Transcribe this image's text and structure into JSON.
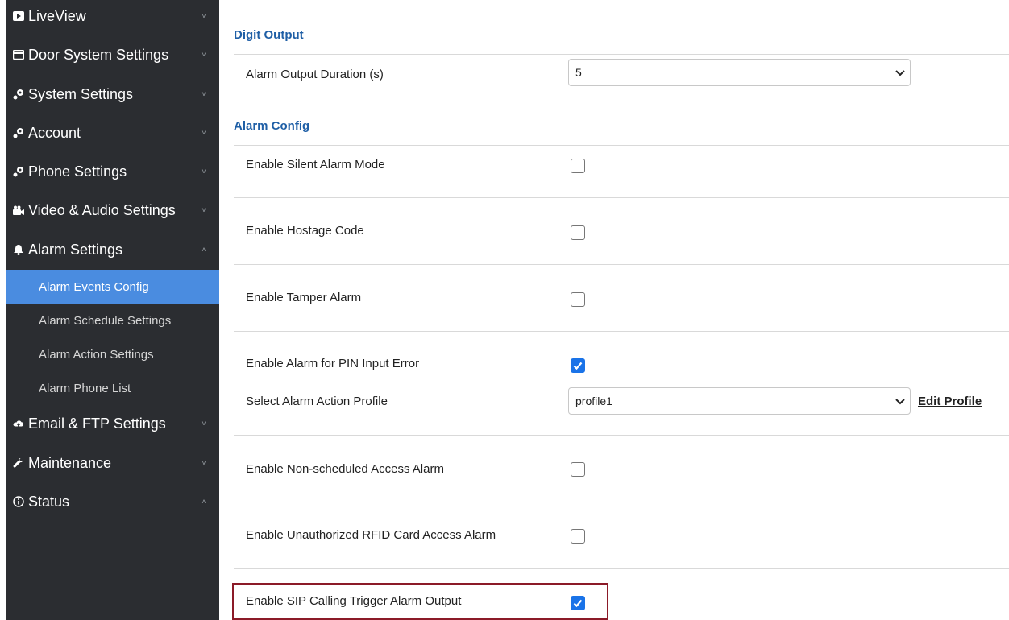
{
  "sidebar": {
    "items": [
      {
        "label": "LiveView",
        "icon": "video-play-icon",
        "chevron": "˅"
      },
      {
        "label": "Door System Settings",
        "icon": "card-icon",
        "chevron": "˅"
      },
      {
        "label": "System Settings",
        "icon": "gears-icon",
        "chevron": "˅"
      },
      {
        "label": "Account",
        "icon": "gears-icon",
        "chevron": "˅"
      },
      {
        "label": "Phone Settings",
        "icon": "gears-icon",
        "chevron": "˅"
      },
      {
        "label": "Video & Audio Settings",
        "icon": "video-camera-icon",
        "chevron": "˅"
      },
      {
        "label": "Alarm Settings",
        "icon": "bell-icon",
        "chevron": "˄"
      },
      {
        "label": "Email & FTP Settings",
        "icon": "cloud-icon",
        "chevron": "˅"
      },
      {
        "label": "Maintenance",
        "icon": "wrench-icon",
        "chevron": "˅"
      },
      {
        "label": "Status",
        "icon": "info-icon",
        "chevron": "˄"
      }
    ],
    "alarm_subitems": [
      {
        "label": "Alarm Events Config",
        "active": true
      },
      {
        "label": "Alarm Schedule Settings",
        "active": false
      },
      {
        "label": "Alarm Action Settings",
        "active": false
      },
      {
        "label": "Alarm Phone List",
        "active": false
      }
    ],
    "colors": {
      "background": "#2b2d31",
      "active": "#4a8ce0"
    }
  },
  "digit_output": {
    "title": "Digit Output",
    "alarm_output_duration": {
      "label": "Alarm Output Duration (s)",
      "value": "5"
    }
  },
  "alarm_config": {
    "title": "Alarm Config",
    "silent_alarm": {
      "label": "Enable Silent Alarm Mode",
      "checked": false
    },
    "hostage_code": {
      "label": "Enable Hostage Code",
      "checked": false
    },
    "tamper_alarm": {
      "label": "Enable Tamper Alarm",
      "checked": false
    },
    "pin_input_error": {
      "label": "Enable Alarm for PIN Input Error",
      "checked": true
    },
    "action_profile": {
      "label": "Select Alarm Action Profile",
      "value": "profile1",
      "edit_label": "Edit Profile"
    },
    "non_scheduled_access": {
      "label": "Enable Non-scheduled Access Alarm",
      "checked": false
    },
    "unauthorized_rfid": {
      "label": "Enable Unauthorized RFID Card Access Alarm",
      "checked": false
    },
    "sip_calling_trigger": {
      "label": "Enable SIP Calling Trigger Alarm Output",
      "checked": true
    }
  },
  "colors": {
    "section_title": "#1f5fa6",
    "checkbox_checked": "#1a73e8",
    "highlight_border": "#8b1a28"
  }
}
